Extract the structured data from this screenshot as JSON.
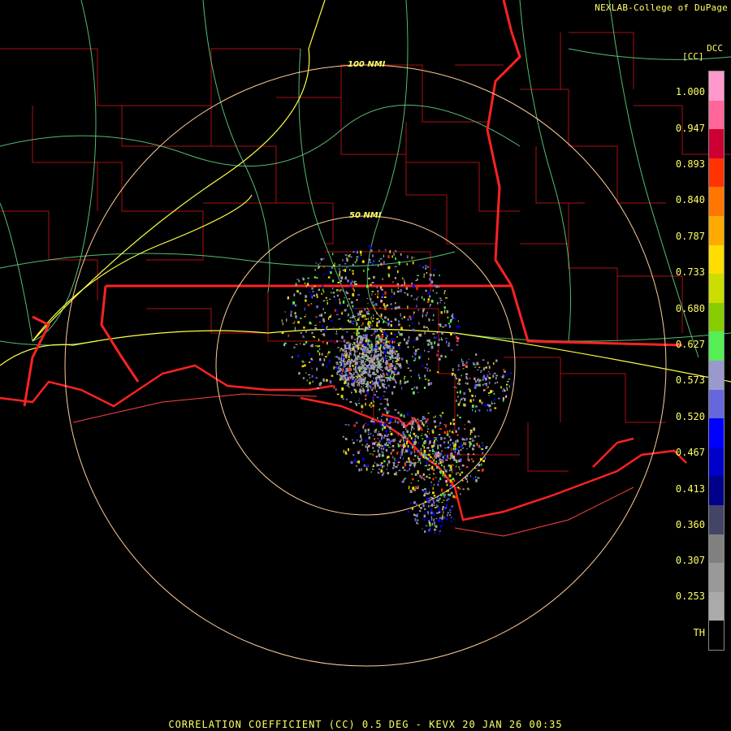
{
  "credit": "NEXLAB-College of DuPage",
  "site_code": "DCC",
  "legend": {
    "unit": "[CC]",
    "labels": [
      "1.000",
      "0.947",
      "0.893",
      "0.840",
      "0.787",
      "0.733",
      "0.680",
      "0.627",
      "0.573",
      "0.520",
      "0.467",
      "0.413",
      "0.360",
      "0.307",
      "0.253",
      "TH"
    ],
    "colors": [
      "#ff99cc",
      "#ff6699",
      "#cc0033",
      "#ff3300",
      "#ff7700",
      "#ffaa00",
      "#ffdd00",
      "#ccdd00",
      "#88cc00",
      "#55ee55",
      "#9999cc",
      "#6666dd",
      "#0000ff",
      "#0000cc",
      "#000088",
      "#444466",
      "#808080",
      "#999999",
      "#aaaaaa",
      "#000000"
    ]
  },
  "rings": [
    "100 NMI",
    "50 NMI"
  ],
  "caption": "CORRELATION COEFFICIENT (CC) 0.5 DEG - KEVX 20 JAN 26 00:35",
  "colors": {
    "state_border": "#ff2222",
    "county_border": "#aa1111",
    "highway": "#66dd88",
    "interstate": "#ffff44",
    "range_ring": "#ffcc99",
    "text": "#ffff66"
  }
}
